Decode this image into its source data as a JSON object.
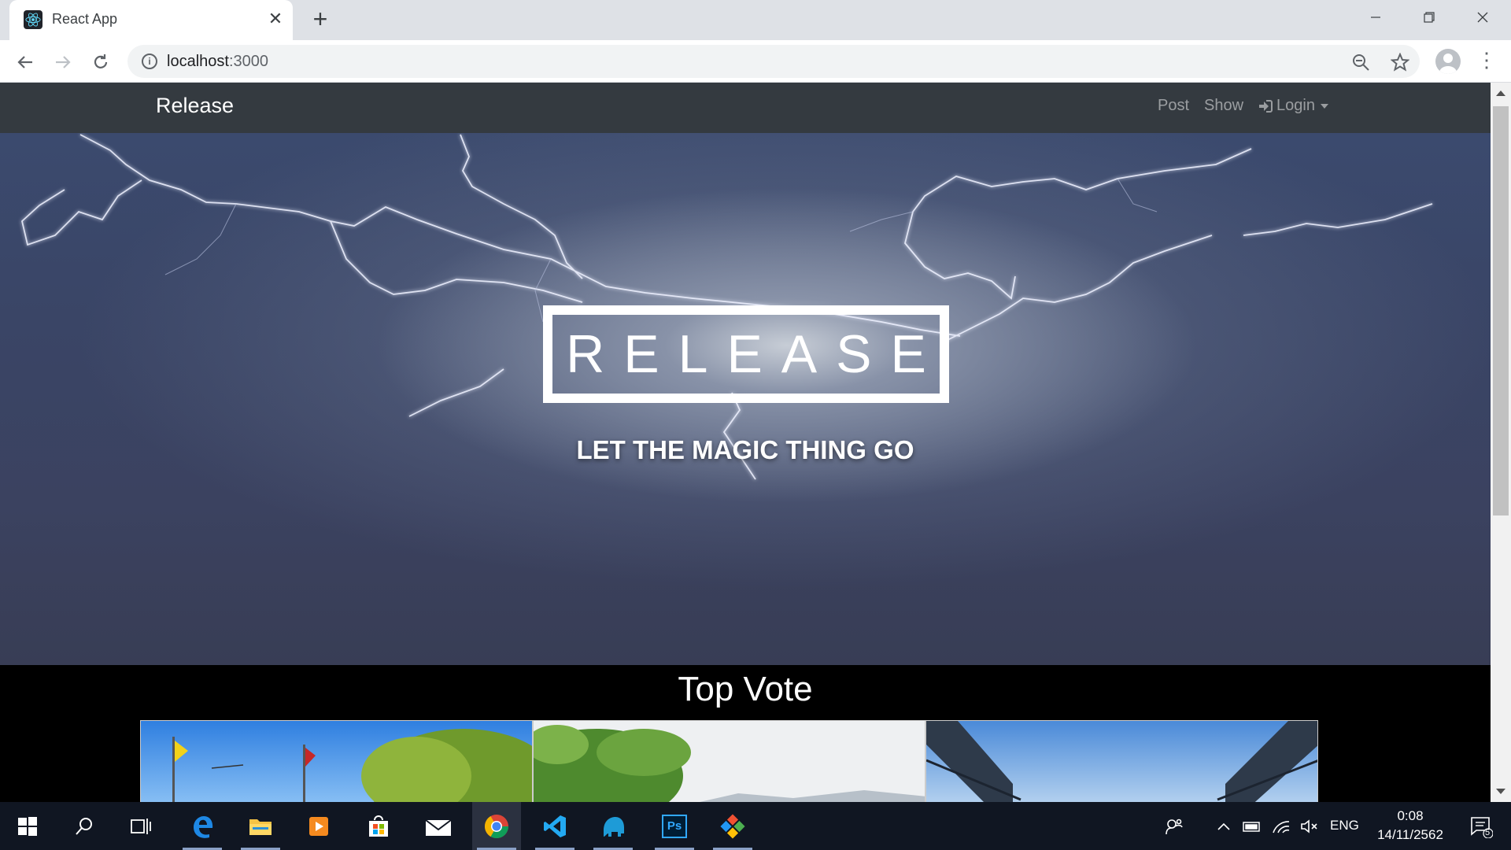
{
  "browser": {
    "tab_title": "React App",
    "tab_close": "✕",
    "new_tab": "+",
    "url_host": "localhost",
    "url_port": ":3000",
    "info_glyph": "i",
    "menu_glyph": "⋮",
    "window_controls": [
      "minimize-icon",
      "restore-icon",
      "close-icon"
    ]
  },
  "navbar": {
    "brand": "Release",
    "links": [
      {
        "label": "Post"
      },
      {
        "label": "Show"
      },
      {
        "label": "Login",
        "icon": "sign-in-icon"
      }
    ]
  },
  "hero": {
    "title": "RELEASE",
    "subtitle": "LET THE MAGIC THING GO",
    "background": "lightning-storm-sky"
  },
  "top_vote": {
    "title": "Top Vote",
    "cards": [
      {
        "image": "temple-flags-trees"
      },
      {
        "image": "tree-mountains"
      },
      {
        "image": "steel-bridge-sky"
      }
    ]
  },
  "taskbar": {
    "apps": [
      "start-icon",
      "search-icon",
      "task-view-icon",
      "edge-icon",
      "file-explorer-icon",
      "media-player-icon",
      "store-icon",
      "mail-icon",
      "chrome-icon",
      "vscode-icon",
      "elephant-app-icon",
      "photoshop-icon",
      "git-kraken-icon"
    ],
    "photoshop_label": "Ps",
    "language": "ENG",
    "time": "0:08",
    "date": "14/11/2562",
    "notifications": "5"
  },
  "colors": {
    "navbar_bg": "#343a40",
    "tabstrip_bg": "#dee1e6",
    "taskbar_bg": "#101622"
  }
}
